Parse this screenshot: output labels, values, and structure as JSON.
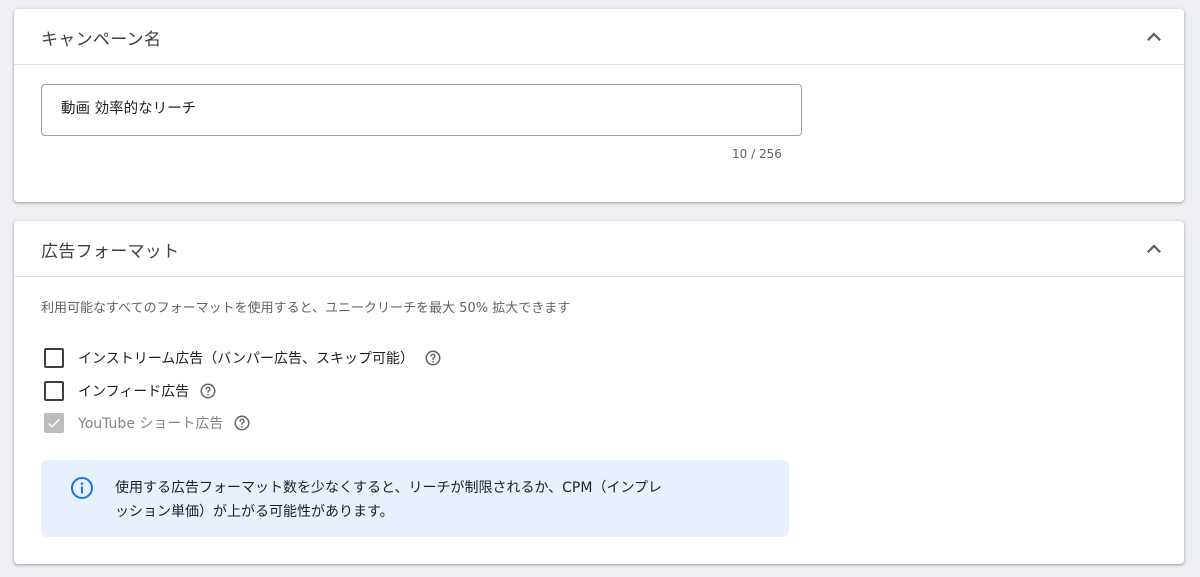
{
  "campaign_name_section": {
    "title": "キャンペーン名",
    "field_value": "動画 効率的なリーチ",
    "char_counter": "10 / 256"
  },
  "ad_format_section": {
    "title": "広告フォーマット",
    "description": "利用可能なすべてのフォーマットを使用すると、ユニークリーチを最大 50% 拡大できます",
    "options": [
      {
        "label": "インストリーム広告（バンパー広告、スキップ可能）",
        "checked": false,
        "disabled": false
      },
      {
        "label": "インフィード広告",
        "checked": false,
        "disabled": false
      },
      {
        "label": "YouTube ショート広告",
        "checked": true,
        "disabled": true
      }
    ],
    "info_line1": "使用する広告フォーマット数を少なくすると、リーチが制限されるか、CPM（インプレ",
    "info_line2": "ッション単価）が上がる可能性があります。"
  },
  "colors": {
    "page_background": "#eef0f3",
    "card_background": "#ffffff",
    "info_background": "#e8f0fe",
    "info_icon": "#1a73e8",
    "disabled_checkbox": "#bdbdbd"
  },
  "icons": [
    "chevron-up-icon",
    "help-circle-icon",
    "info-icon",
    "checkmark-icon"
  ]
}
